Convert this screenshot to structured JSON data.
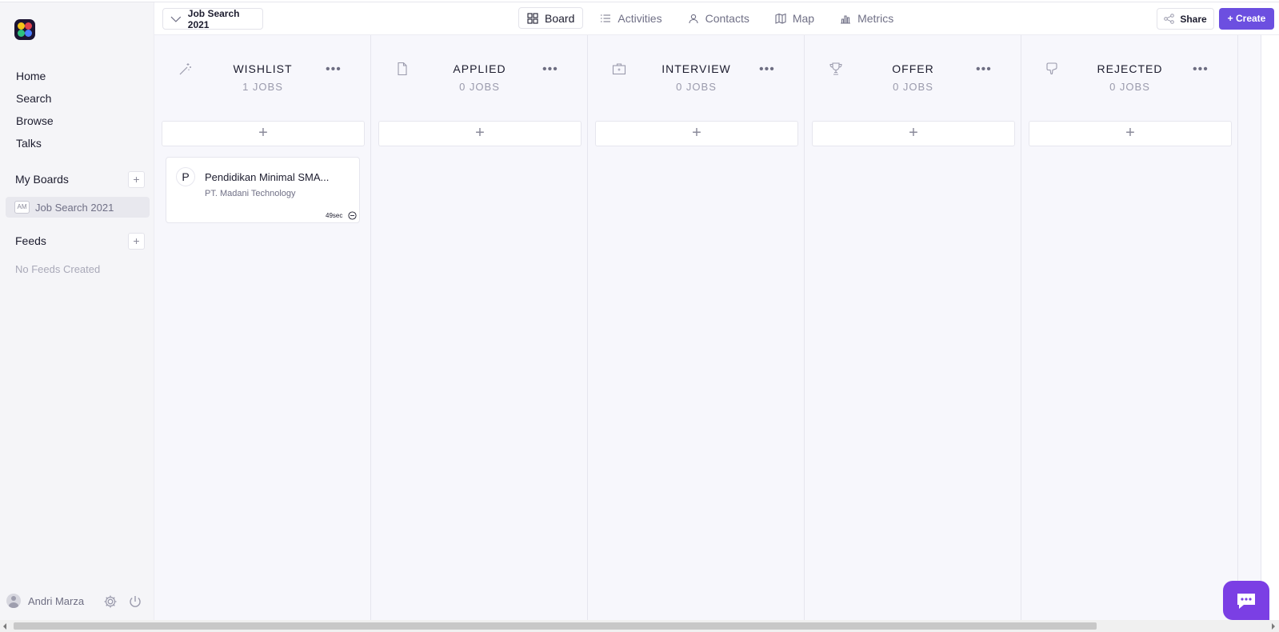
{
  "sidebar": {
    "nav": [
      "Home",
      "Search",
      "Browse",
      "Talks"
    ],
    "my_boards_label": "My Boards",
    "boards": [
      {
        "badge": "AM",
        "label": "Job Search 2021"
      }
    ],
    "feeds_label": "Feeds",
    "no_feeds": "No Feeds Created",
    "user_name": "Andri Marza",
    "add_symbol": "+"
  },
  "header": {
    "board_select": "Job Search 2021",
    "tabs": [
      "Board",
      "Activities",
      "Contacts",
      "Map",
      "Metrics"
    ],
    "active_tab": "Board",
    "share_label": "Share",
    "create_label": "+ Create"
  },
  "columns": [
    {
      "title": "WISHLIST",
      "count": "1 JOBS",
      "icon": "magic-wand-icon"
    },
    {
      "title": "APPLIED",
      "count": "0 JOBS",
      "icon": "document-icon"
    },
    {
      "title": "INTERVIEW",
      "count": "0 JOBS",
      "icon": "briefcase-icon"
    },
    {
      "title": "OFFER",
      "count": "0 JOBS",
      "icon": "trophy-icon"
    },
    {
      "title": "REJECTED",
      "count": "0 JOBS",
      "icon": "thumbs-down-icon"
    }
  ],
  "column_more": "•••",
  "column_add": "+",
  "job_card": {
    "logo_letter": "P",
    "title": "Pendidikan Minimal SMA...",
    "company": "PT. Madani Technology",
    "time": "49sec"
  },
  "colors": {
    "accent": "#6c4fe0",
    "chat": "#7b3fe4"
  }
}
